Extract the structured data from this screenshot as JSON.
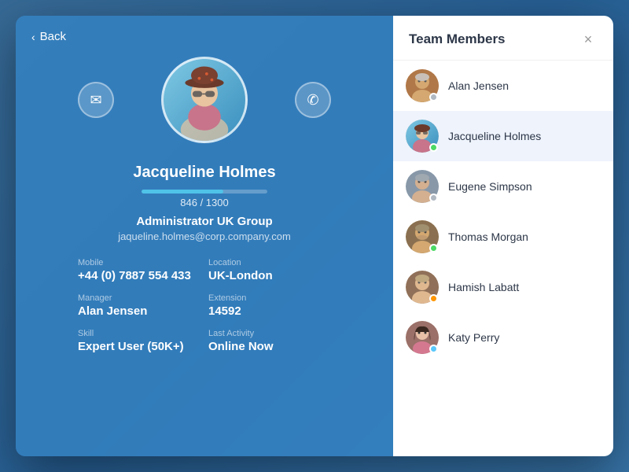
{
  "backdrop": {
    "description": "blurred photo background"
  },
  "left_panel": {
    "back_label": "Back",
    "email_icon": "✉",
    "phone_icon": "✆",
    "profile": {
      "name": "Jacqueline Holmes",
      "progress_current": "846",
      "progress_max": "1300",
      "progress_text": "846 / 1300",
      "progress_percent": 65,
      "role": "Administrator UK Group",
      "email": "jaqueline.holmes@corp.company.com"
    },
    "details": [
      {
        "label": "Mobile",
        "value": "+44 (0) 7887 554 433"
      },
      {
        "label": "Location",
        "value": "UK-London"
      },
      {
        "label": "Manager",
        "value": "Alan Jensen"
      },
      {
        "label": "Extension",
        "value": "14592"
      },
      {
        "label": "Skill",
        "value": "Expert User (50K+)"
      },
      {
        "label": "Last Activity",
        "value": "Online Now"
      }
    ]
  },
  "right_panel": {
    "title": "Team Members",
    "close_label": "×",
    "members": [
      {
        "name": "Alan Jensen",
        "status": "gray",
        "id": "alan-jensen"
      },
      {
        "name": "Jacqueline Holmes",
        "status": "green",
        "id": "jacqueline-holmes",
        "active": true
      },
      {
        "name": "Eugene Simpson",
        "status": "gray",
        "id": "eugene-simpson"
      },
      {
        "name": "Thomas Morgan",
        "status": "green",
        "id": "thomas-morgan"
      },
      {
        "name": "Hamish Labatt",
        "status": "orange",
        "id": "hamish-labatt"
      },
      {
        "name": "Katy Perry",
        "status": "teal",
        "id": "katy-perry"
      }
    ]
  }
}
